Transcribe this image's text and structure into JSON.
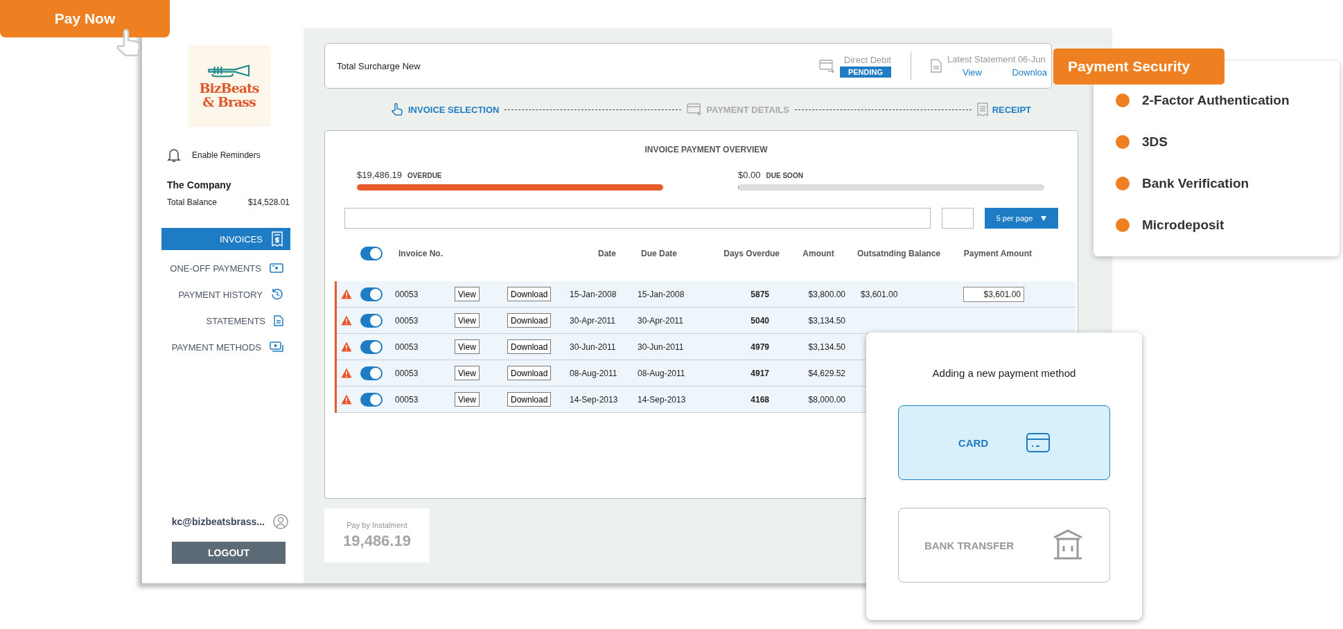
{
  "pay_now": {
    "label": "Pay Now"
  },
  "sidebar": {
    "logo": {
      "line1": "BizBeats",
      "line2": "& Brass"
    },
    "reminders": "Enable Reminders",
    "company": "The Company",
    "balance_label": "Total Balance",
    "balance": "$14,528.01",
    "items": [
      {
        "label": "INVOICES",
        "selected": true,
        "kind": "receipt"
      },
      {
        "label": "ONE-OFF PAYMENTS",
        "selected": false,
        "kind": "cash"
      },
      {
        "label": "PAYMENT HISTORY",
        "selected": false,
        "kind": "history"
      },
      {
        "label": "STATEMENTS",
        "selected": false,
        "kind": "document"
      },
      {
        "label": "PAYMENT METHODS",
        "selected": false,
        "kind": "money"
      }
    ],
    "user": "kc@bizbeatsbrass...",
    "logout": "LOGOUT"
  },
  "summary": {
    "title": "Total Surcharge New",
    "debit_label": "Direct Debit",
    "debit_status": "PENDING",
    "statement_label": "Latest Statement 06-Jun",
    "view": "View",
    "download": "Downloa"
  },
  "steps": [
    {
      "label": "INVOICE SELECTION",
      "active": true,
      "kind": "hand"
    },
    {
      "label": "PAYMENT DETAILS",
      "active": false,
      "kind": "card"
    },
    {
      "label": "RECEIPT",
      "active": true,
      "kind": "receipt"
    }
  ],
  "overview": {
    "title": "INVOICE PAYMENT OVERVIEW",
    "meters": [
      {
        "amount": "$19,486.19",
        "label": "OVERDUE",
        "level": 1
      },
      {
        "amount": "$0.00",
        "label": "DUE SOON",
        "level": 0
      }
    ],
    "per_page": "5 per page",
    "select_all": {
      "on": true
    },
    "columns": [
      "Invoice No.",
      "Date",
      "Due Date",
      "Days Overdue",
      "Amount",
      "Outsatnding Balance",
      "Payment Amount"
    ],
    "rows": [
      {
        "on": true,
        "invoice": "00053",
        "view": "View",
        "download": "Download",
        "date": "15-Jan-2008",
        "due": "15-Jan-2008",
        "days": "5875",
        "amount": "$3,800.00",
        "outstanding": "$3,601.00",
        "payment": "$3,601.00"
      },
      {
        "on": true,
        "invoice": "00053",
        "view": "View",
        "download": "Download",
        "date": "30-Apr-2011",
        "due": "30-Apr-2011",
        "days": "5040",
        "amount": "$3,134.50"
      },
      {
        "on": true,
        "invoice": "00053",
        "view": "View",
        "download": "Download",
        "date": "30-Jun-2011",
        "due": "30-Jun-2011",
        "days": "4979",
        "amount": "$3,134.50"
      },
      {
        "on": true,
        "invoice": "00053",
        "view": "View",
        "download": "Download",
        "date": "08-Aug-2011",
        "due": "08-Aug-2011",
        "days": "4917",
        "amount": "$4,629.52"
      },
      {
        "on": true,
        "invoice": "00053",
        "view": "View",
        "download": "Download",
        "date": "14-Sep-2013",
        "due": "14-Sep-2013",
        "days": "4168",
        "amount": "$8,000.00"
      }
    ]
  },
  "instalment": {
    "label": "Pay by Instalment",
    "amount": "19,486.19"
  },
  "security": {
    "title": "Payment Security",
    "items": [
      {
        "label": "2-Factor Authentication",
        "color": "#ef8022"
      },
      {
        "label": "3DS",
        "color": "#ef8022"
      },
      {
        "label": "Bank Verification",
        "color": "#ef8022"
      },
      {
        "label": "Microdeposit",
        "color": "#ef8022"
      }
    ]
  },
  "new_method": {
    "title": "Adding a new payment method",
    "options": [
      {
        "label": "CARD",
        "selected": true,
        "kind": "card"
      },
      {
        "label": "BANK TRANSFER",
        "selected": false,
        "kind": "bank"
      }
    ]
  }
}
